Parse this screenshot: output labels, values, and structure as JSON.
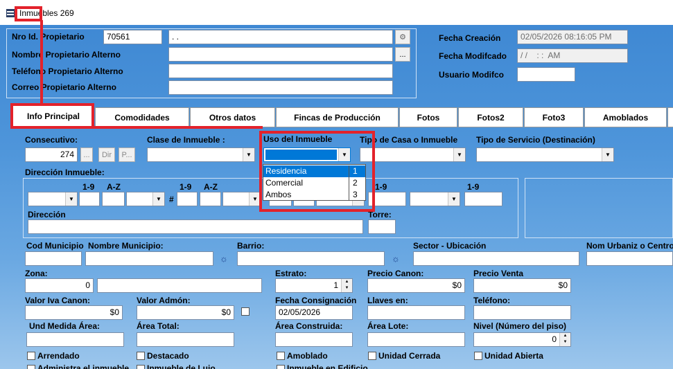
{
  "window": {
    "title": "Inmuebles 269"
  },
  "owner": {
    "nro_label": "Nro Id. Propietario",
    "nro_value": "70561",
    "name_value": ". .",
    "alt_name_label": "Nombre Propietario Alterno",
    "alt_phone_label": "Teléfono Propietario Alterno",
    "alt_email_label": "Correo Propietario Alterno",
    "ellipsis": "..."
  },
  "meta": {
    "created_label": "Fecha Creación",
    "created_value": "02/05/2026 08:16:05 PM",
    "modified_label": "Fecha Modifcado",
    "modified_value": "/ /    : :  AM",
    "user_label": "Usuario Modifco"
  },
  "tabs": [
    "Info Principal",
    "Comodidades",
    "Otros datos",
    "Fincas de Producción",
    "Fotos",
    "Fotos2",
    "Foto3",
    "Amoblados"
  ],
  "form": {
    "consecutivo_label": "Consecutivo:",
    "consecutivo_value": "274",
    "btn_dots": "...",
    "btn_dir": "Dir",
    "btn_p": "P...",
    "clase_label": "Clase de Inmueble :",
    "uso_label": "Uso del Inmueble",
    "tipo_casa_label": "Tipo de Casa o Inmueble",
    "tipo_servicio_label": "Tipo de Servicio (Destinación)",
    "direccion_inmueble_label": "Dirección Inmueble:",
    "col_19": "1-9",
    "col_az": "A-Z",
    "hash": "#",
    "direccion_label": "Dirección",
    "torre_label": "Torre:",
    "cod_municipio_label": "Cod Municipio",
    "nombre_municipio_label": "Nombre Municipio:",
    "barrio_label": "Barrio:",
    "sector_label": "Sector - Ubicación",
    "urbaniz_label": "Nom Urbaniz o Centro",
    "zona_label": "Zona:",
    "zona_value": "0",
    "estrato_label": "Estrato:",
    "estrato_value": "1",
    "precio_canon_label": "Precio Canon:",
    "precio_canon_value": "$0",
    "precio_venta_label": "Precio Venta",
    "precio_venta_value": "$0",
    "valor_iva_label": "Valor Iva Canon:",
    "valor_iva_value": "$0",
    "valor_admon_label": "Valor Admón:",
    "valor_admon_value": "$0",
    "fecha_consig_label": "Fecha Consignación",
    "fecha_consig_value": "02/05/2026",
    "llaves_label": "Llaves en:",
    "telefono_label": "Teléfono:",
    "und_medida_label": "Und Medida Área:",
    "area_total_label": "Área Total:",
    "area_construida_label": "Área Construida:",
    "area_lote_label": "Área Lote:",
    "nivel_label": "Nivel (Número del piso)",
    "nivel_value": "0",
    "arrendado_label": "Arrendado",
    "destacado_label": "Destacado",
    "amoblado_label": "Amoblado",
    "unidad_cerrada_label": "Unidad Cerrada",
    "unidad_abierta_label": "Unidad Abierta",
    "administra_label": "Administra el inmueble",
    "inmueble_lujo_label": "Inmueble de Lujo",
    "inmueble_edificio_label": "Inmueble en Edificio"
  },
  "uso_dropdown": {
    "options": [
      {
        "label": "Residencia",
        "code": "1"
      },
      {
        "label": "Comercial",
        "code": "2"
      },
      {
        "label": "Ambos",
        "code": "3"
      }
    ]
  },
  "colors": {
    "highlight": "#e3222b",
    "selection": "#0078d7"
  }
}
